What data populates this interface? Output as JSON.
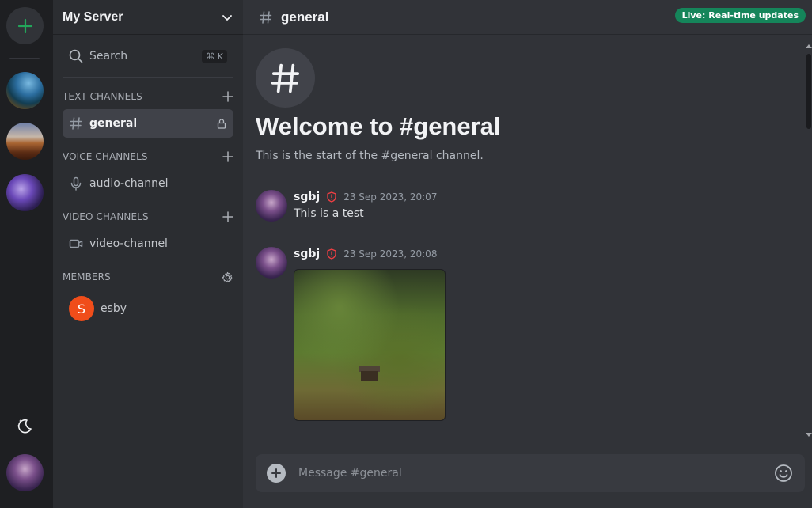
{
  "colors": {
    "accent_green": "#23a55a",
    "live_badge": "#15855a",
    "member_avatar": "#f04d1a",
    "mod_badge": "#f23f43"
  },
  "rail": {
    "add_server_icon": "plus-icon",
    "theme_toggle_icon": "moon-stars-icon"
  },
  "server": {
    "name": "My Server",
    "dropdown_icon": "chevron-down-icon"
  },
  "search": {
    "label": "Search",
    "shortcut": "⌘ K"
  },
  "categories": {
    "text": "TEXT CHANNELS",
    "voice": "VOICE CHANNELS",
    "video": "VIDEO CHANNELS",
    "members": "MEMBERS"
  },
  "channels": {
    "text": "general",
    "voice": "audio-channel",
    "video": "video-channel"
  },
  "members": [
    {
      "initial": "S",
      "name": "esby"
    }
  ],
  "header": {
    "channel": "general",
    "live_badge": "Live: Real-time updates"
  },
  "welcome": {
    "title": "Welcome to #general",
    "subtitle": "This is the start of the #general channel."
  },
  "messages": [
    {
      "author": "sgbj",
      "time": "23 Sep 2023, 20:07",
      "text": "This is a test"
    },
    {
      "author": "sgbj",
      "time": "23 Sep 2023, 20:08",
      "attachment": "image"
    }
  ],
  "composer": {
    "placeholder": "Message #general"
  }
}
